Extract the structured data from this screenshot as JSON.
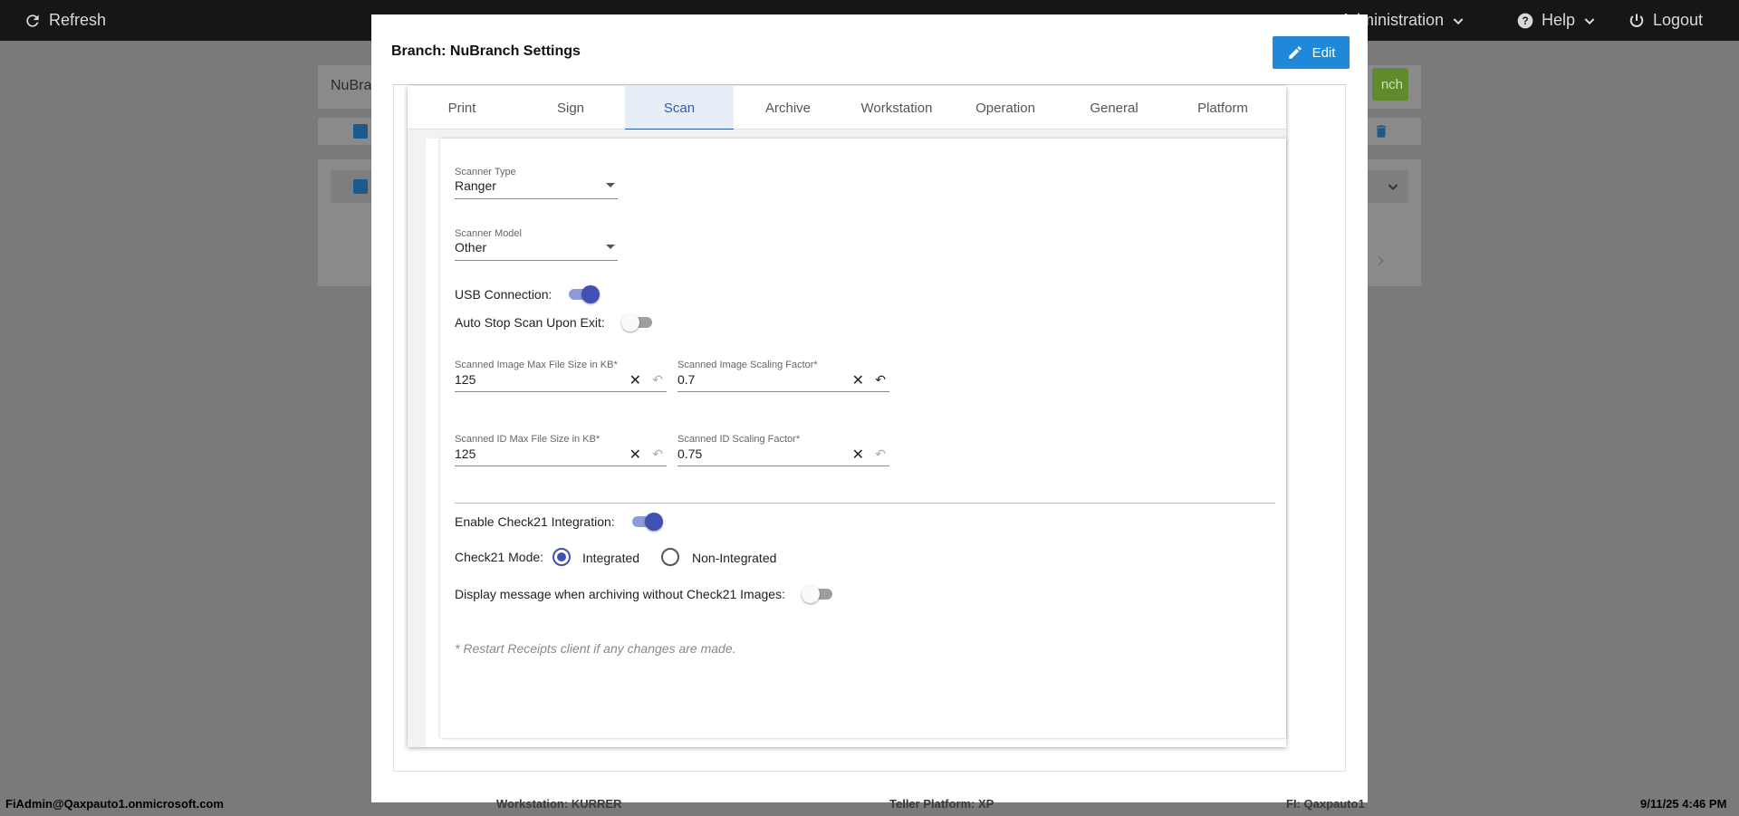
{
  "topbar": {
    "refresh_label": "Refresh",
    "administration_label": "Administration",
    "help_label": "Help",
    "logout_label": "Logout"
  },
  "background": {
    "search_text": "NuBra",
    "add_button_text": "nch"
  },
  "modal": {
    "title": "Branch: NuBranch Settings",
    "edit_label": "Edit",
    "tabs": [
      {
        "label": "Print"
      },
      {
        "label": "Sign"
      },
      {
        "label": "Scan"
      },
      {
        "label": "Archive"
      },
      {
        "label": "Workstation"
      },
      {
        "label": "Operation"
      },
      {
        "label": "General"
      },
      {
        "label": "Platform"
      }
    ],
    "active_tab": "Scan"
  },
  "scan": {
    "scanner_type": {
      "label": "Scanner Type",
      "value": "Ranger"
    },
    "scanner_model": {
      "label": "Scanner Model",
      "value": "Other"
    },
    "usb_connection": {
      "label": "USB Connection:",
      "on": true
    },
    "auto_stop": {
      "label": "Auto Stop Scan Upon Exit:",
      "on": false
    },
    "image_max_size": {
      "label": "Scanned Image Max File Size in KB*",
      "value": "125"
    },
    "image_scaling": {
      "label": "Scanned Image Scaling Factor*",
      "value": "0.7"
    },
    "id_max_size": {
      "label": "Scanned ID Max File Size in KB*",
      "value": "125"
    },
    "id_scaling": {
      "label": "Scanned ID Scaling Factor*",
      "value": "0.75"
    },
    "check21_enable": {
      "label": "Enable Check21 Integration:",
      "on": true
    },
    "check21_mode": {
      "label": "Check21 Mode:",
      "options": [
        "Integrated",
        "Non-Integrated"
      ],
      "selected": "Integrated"
    },
    "display_message": {
      "label": "Display message when archiving without Check21 Images:",
      "on": false
    },
    "note": "* Restart Receipts client if any changes are made."
  },
  "statusbar": {
    "user": "FiAdmin@Qaxpauto1.onmicrosoft.com",
    "workstation": "Workstation: KURRER",
    "teller_platform": "Teller Platform: XP",
    "fi": "FI: Qaxpauto1",
    "datetime": "9/11/25 4:46 PM"
  },
  "colors": {
    "accent": "#3f51b5",
    "edit_button": "#1f88d8",
    "tab_active": "#2a5db0",
    "topbar": "#161616"
  }
}
